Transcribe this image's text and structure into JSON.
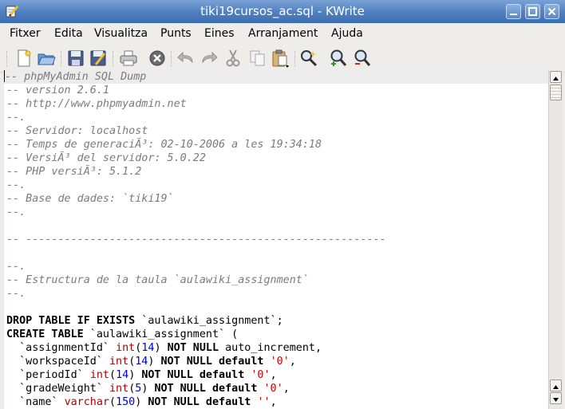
{
  "window": {
    "title": "tiki19cursos_ac.sql - KWrite",
    "accent": "#4f7fbf"
  },
  "menu": [
    "Fitxer",
    "Edita",
    "Visualitza",
    "Punts",
    "Eines",
    "Arranjament",
    "Ajuda"
  ],
  "toolbar": [
    {
      "icon": "new-document-icon"
    },
    {
      "icon": "open-folder-icon"
    },
    {
      "icon": "save-icon"
    },
    {
      "icon": "save-as-icon"
    },
    {
      "icon": "print-icon"
    },
    {
      "icon": "close-document-icon"
    },
    {
      "icon": "undo-icon"
    },
    {
      "icon": "redo-icon"
    },
    {
      "icon": "cut-icon"
    },
    {
      "icon": "copy-icon"
    },
    {
      "icon": "paste-icon"
    },
    {
      "icon": "find-icon"
    },
    {
      "icon": "zoom-in-icon"
    },
    {
      "icon": "zoom-out-icon"
    }
  ],
  "editor": {
    "lines": [
      [
        {
          "t": "-- phpMyAdmin SQL Dump",
          "c": "cm"
        }
      ],
      [
        {
          "t": "-- version 2.6.1",
          "c": "cm"
        }
      ],
      [
        {
          "t": "-- http://www.phpmyadmin.net",
          "c": "cm"
        }
      ],
      [
        {
          "t": "--.",
          "c": "cm"
        }
      ],
      [
        {
          "t": "-- Servidor: localhost",
          "c": "cm"
        }
      ],
      [
        {
          "t": "-- Temps de generaciÃ³: 02-10-2006 a les 19:34:18",
          "c": "cm"
        }
      ],
      [
        {
          "t": "-- VersiÃ³ del servidor: 5.0.22",
          "c": "cm"
        }
      ],
      [
        {
          "t": "-- PHP versiÃ³: 5.1.2",
          "c": "cm"
        }
      ],
      [
        {
          "t": "--.",
          "c": "cm"
        }
      ],
      [
        {
          "t": "-- Base de dades: `tiki19`",
          "c": "cm"
        }
      ],
      [
        {
          "t": "--.",
          "c": "cm"
        }
      ],
      [],
      [
        {
          "t": "-- --------------------------------------------------------",
          "c": "cm"
        }
      ],
      [],
      [
        {
          "t": "--.",
          "c": "cm"
        }
      ],
      [
        {
          "t": "-- Estructura de la taula `aulawiki_assignment`",
          "c": "cm"
        }
      ],
      [
        {
          "t": "--.",
          "c": "cm"
        }
      ],
      [],
      [
        {
          "t": "DROP TABLE IF EXISTS",
          "c": "kw"
        },
        {
          "t": " `aulawiki_assignment`;",
          "c": "tx"
        }
      ],
      [
        {
          "t": "CREATE TABLE",
          "c": "kw"
        },
        {
          "t": " `aulawiki_assignment` (",
          "c": "tx"
        }
      ],
      [
        {
          "t": "  `assignmentId` ",
          "c": "tx"
        },
        {
          "t": "int",
          "c": "ty"
        },
        {
          "t": "(",
          "c": "tx"
        },
        {
          "t": "14",
          "c": "nm"
        },
        {
          "t": ") ",
          "c": "tx"
        },
        {
          "t": "NOT NULL",
          "c": "kw"
        },
        {
          "t": " auto_increment,",
          "c": "tx"
        }
      ],
      [
        {
          "t": "  `workspaceId` ",
          "c": "tx"
        },
        {
          "t": "int",
          "c": "ty"
        },
        {
          "t": "(",
          "c": "tx"
        },
        {
          "t": "14",
          "c": "nm"
        },
        {
          "t": ") ",
          "c": "tx"
        },
        {
          "t": "NOT NULL default",
          "c": "kw"
        },
        {
          "t": " ",
          "c": "tx"
        },
        {
          "t": "'0'",
          "c": "st"
        },
        {
          "t": ",",
          "c": "tx"
        }
      ],
      [
        {
          "t": "  `periodId` ",
          "c": "tx"
        },
        {
          "t": "int",
          "c": "ty"
        },
        {
          "t": "(",
          "c": "tx"
        },
        {
          "t": "14",
          "c": "nm"
        },
        {
          "t": ") ",
          "c": "tx"
        },
        {
          "t": "NOT NULL default",
          "c": "kw"
        },
        {
          "t": " ",
          "c": "tx"
        },
        {
          "t": "'0'",
          "c": "st"
        },
        {
          "t": ",",
          "c": "tx"
        }
      ],
      [
        {
          "t": "  `gradeWeight` ",
          "c": "tx"
        },
        {
          "t": "int",
          "c": "ty"
        },
        {
          "t": "(",
          "c": "tx"
        },
        {
          "t": "5",
          "c": "nm"
        },
        {
          "t": ") ",
          "c": "tx"
        },
        {
          "t": "NOT NULL default",
          "c": "kw"
        },
        {
          "t": " ",
          "c": "tx"
        },
        {
          "t": "'0'",
          "c": "st"
        },
        {
          "t": ",",
          "c": "tx"
        }
      ],
      [
        {
          "t": "  `name` ",
          "c": "tx"
        },
        {
          "t": "varchar",
          "c": "ty"
        },
        {
          "t": "(",
          "c": "tx"
        },
        {
          "t": "150",
          "c": "nm"
        },
        {
          "t": ") ",
          "c": "tx"
        },
        {
          "t": "NOT NULL default",
          "c": "kw"
        },
        {
          "t": " ",
          "c": "tx"
        },
        {
          "t": "''",
          "c": "st"
        },
        {
          "t": ",",
          "c": "tx"
        }
      ]
    ]
  }
}
